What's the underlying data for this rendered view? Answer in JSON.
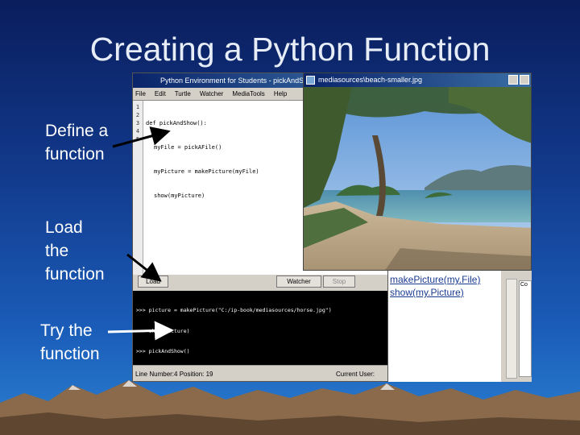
{
  "slide": {
    "title": "Creating a Python Function",
    "callouts": {
      "define": [
        "Define a",
        "function"
      ],
      "load": [
        "Load",
        "the",
        "function"
      ],
      "try": [
        "Try the",
        "function"
      ]
    }
  },
  "jes": {
    "title": "Python Environment for Students - pickAndSh",
    "menu": [
      "File",
      "Edit",
      "Turtle",
      "Watcher",
      "MediaTools",
      "Help"
    ],
    "gutter": [
      "1",
      "2",
      "3",
      "4",
      "5"
    ],
    "code": [
      "def pickAndShow():",
      "myFile = pickAFile()",
      "myPicture = makePicture(myFile)",
      "show(myPicture)"
    ],
    "buttons": {
      "load": "Load",
      "watcher": "Watcher",
      "stop": "Stop"
    },
    "console": [
      ">>> picture = makePicture(\"C:/ip-book/mediasources/horse.jpg\")",
      ">>> show(picture)",
      ">>> pickAndShow()",
      ">>>"
    ],
    "status": {
      "position": "Line Number:4 Position: 19",
      "user": "Current User:"
    }
  },
  "viewer": {
    "title": "mediasources\\beach-smaller.jpg"
  },
  "side": {
    "line1": "makePicture(my.File)",
    "line2": "show(my.Picture)",
    "fragment": "Co"
  }
}
